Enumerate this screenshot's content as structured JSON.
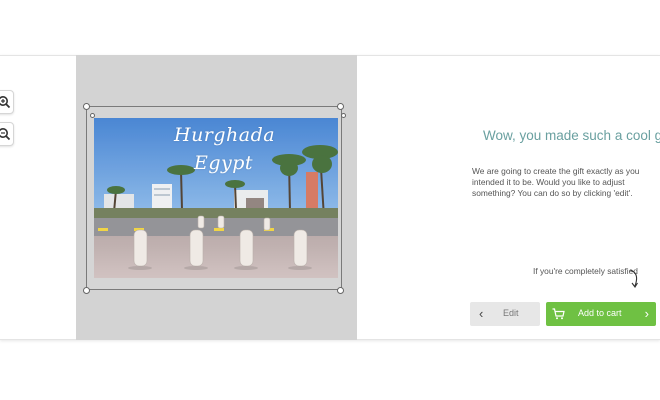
{
  "image_text": {
    "line1": "Hurghada",
    "line2": "Egypt"
  },
  "icons": {
    "zoom_in": "zoom-in-icon",
    "zoom_out": "zoom-out-icon",
    "cart": "cart-icon",
    "back": "chevron-left-icon",
    "forward": "chevron-right-icon"
  },
  "message": {
    "headline": "Wow, you made such a cool gift!",
    "description": "We are going to create the gift exactly as you intended it to be. Would you like to adjust something? You can do so by clicking 'edit'.",
    "satisfied_hint": "If you're completely satisfied"
  },
  "buttons": {
    "edit": "Edit",
    "add_to_cart": "Add to cart"
  },
  "colors": {
    "accent_green": "#6fc143",
    "headline_teal": "#6aa0a0",
    "canvas_gray": "#d3d3d3"
  }
}
